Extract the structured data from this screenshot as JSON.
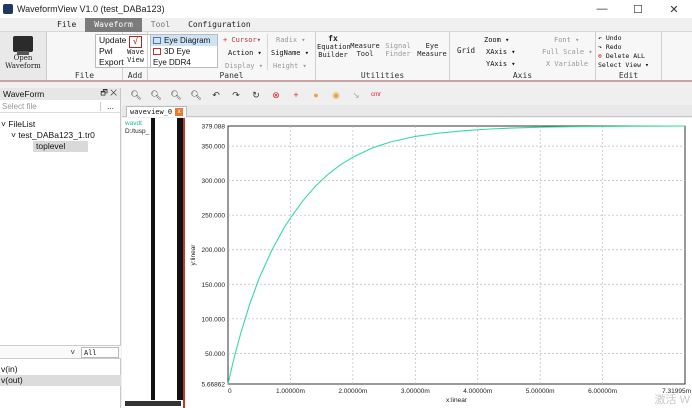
{
  "window": {
    "title": "WaveformView V1.0 (test_DABa123)",
    "controls": [
      "—",
      "☐",
      "✕"
    ]
  },
  "menu": {
    "tabs": [
      {
        "label": "File",
        "state": "normal"
      },
      {
        "label": "Waveform",
        "state": "active"
      },
      {
        "label": "Tool",
        "state": "dim"
      },
      {
        "label": "Configuration",
        "state": "normal"
      }
    ]
  },
  "ribbon": {
    "open_waveform": "Open Waveform",
    "file_items": [
      "Update",
      "Pwl",
      "Export"
    ],
    "file_group": "File",
    "wave_view": "Wave View",
    "add_group": "Add",
    "eye_items": [
      "Eye Diagram",
      "3D Eye",
      "Eye DDR4"
    ],
    "cursor_btn": "+ Cursor▾",
    "action_btn": "Action ▾",
    "display_btn": "Display ▾",
    "radix_btn": "Radix ▾",
    "signame_btn": "SigName ▾",
    "height_btn": "Height ▾",
    "panel_group": "Panel",
    "equation_builder": "Equation Builder",
    "measure_tool": "Measure Tool",
    "signal_finder": "Signal Finder",
    "eye_measure": "Eye Measure",
    "utilities_group": "Utilities",
    "grid_btn": "Grid",
    "zoom_btn": "Zoom ▾",
    "xaxis_btn": "XAxis ▾",
    "yaxis_btn": "YAxis ▾",
    "font_btn": "Font ▾",
    "fullscale_btn": "Full Scale ▾",
    "xvariable_btn": "X Variable",
    "axis_group": "Axis",
    "undo": "Undo",
    "redo": "Redo",
    "delete_all": "Delete ALL",
    "select_view": "Select View ▾",
    "edit_group": "Edit"
  },
  "left_panel": {
    "title": "WaveForm",
    "header_icons": "🗗 ✕",
    "filter_placeholder": "Select file",
    "filter_button": "...",
    "tree": [
      {
        "label": "˅ FileList",
        "indent": 0,
        "selected": false
      },
      {
        "label": "˅ test_DABa123_1.tr0",
        "indent": 1,
        "selected": false
      },
      {
        "label": "toplevel",
        "indent": 2,
        "selected": true
      }
    ],
    "scope_value": "All",
    "scope_arrow": "˅",
    "signals": [
      {
        "label": "v(in)",
        "selected": false
      },
      {
        "label": "v(out)",
        "selected": true
      }
    ]
  },
  "wave_toolbar": {
    "icons": [
      {
        "name": "zoom-in-icon",
        "glyph": "🔍︎",
        "cls": ""
      },
      {
        "name": "zoom-out-icon",
        "glyph": "🔍︎",
        "cls": ""
      },
      {
        "name": "zoom-fit-icon",
        "glyph": "🔍︎",
        "cls": ""
      },
      {
        "name": "zoom-area-icon",
        "glyph": "🔍︎",
        "cls": ""
      },
      {
        "name": "undo-view-icon",
        "glyph": "↶",
        "cls": ""
      },
      {
        "name": "redo-view-icon",
        "glyph": "↷",
        "cls": ""
      },
      {
        "name": "refresh-icon",
        "glyph": "↻",
        "cls": ""
      },
      {
        "name": "stop-icon",
        "glyph": "⊗",
        "cls": "red"
      },
      {
        "name": "crosshair-icon",
        "glyph": "+",
        "cls": "red"
      },
      {
        "name": "marker-icon",
        "glyph": "●",
        "cls": "org"
      },
      {
        "name": "delta-marker-icon",
        "glyph": "◉",
        "cls": "org"
      },
      {
        "name": "measure-icon",
        "glyph": "↘",
        "cls": "faint"
      },
      {
        "name": "cmr-icon",
        "glyph": "cmr",
        "cls": "tiny"
      }
    ]
  },
  "wave_tab": {
    "label": "waveview_0",
    "close": "x"
  },
  "signal_column": {
    "group": "wavdt",
    "signal": "D:/tusp_"
  },
  "chart_data": {
    "type": "line",
    "xlabel": "x:linear",
    "ylabel": "y:linear",
    "xlim": [
      0,
      7.31995
    ],
    "ylim": [
      5.66862,
      379.088
    ],
    "xticks": [
      {
        "v": 0,
        "label": "0"
      },
      {
        "v": 1,
        "label": "1.00000m"
      },
      {
        "v": 2,
        "label": "2.00000m"
      },
      {
        "v": 3,
        "label": "3.00000m"
      },
      {
        "v": 4,
        "label": "4.00000m"
      },
      {
        "v": 5,
        "label": "5.00000m"
      },
      {
        "v": 6,
        "label": "6.00000m"
      },
      {
        "v": 7.31995,
        "label": "7.31995m"
      }
    ],
    "yticks": [
      {
        "v": 5.66862,
        "label": "5.66862"
      },
      {
        "v": 50,
        "label": "50.000"
      },
      {
        "v": 100,
        "label": "100.000"
      },
      {
        "v": 150,
        "label": "150.000"
      },
      {
        "v": 200,
        "label": "200.000"
      },
      {
        "v": 250,
        "label": "250.000"
      },
      {
        "v": 300,
        "label": "300.000"
      },
      {
        "v": 350,
        "label": "350.000"
      },
      {
        "v": 379.088,
        "label": "379.088"
      }
    ],
    "grid": true,
    "series": [
      {
        "color": "#33dd99",
        "x": [
          0,
          0.1,
          0.2,
          0.35,
          0.5,
          0.7,
          0.9,
          1.0,
          1.2,
          1.4,
          1.6,
          1.8,
          2.0,
          2.3,
          2.6,
          3.0,
          3.4,
          3.8,
          4.2,
          4.6,
          5.0,
          5.5,
          6.0,
          6.5,
          7.0,
          7.31995
        ],
        "y": [
          5.67,
          44.0,
          78.0,
          122.0,
          159.0,
          199.0,
          232.0,
          246.0,
          271.0,
          292.0,
          309.0,
          323.0,
          334.0,
          347.0,
          356.0,
          364.0,
          369.0,
          372.5,
          374.8,
          376.3,
          377.3,
          378.1,
          378.5,
          378.8,
          379.0,
          379.088
        ]
      }
    ]
  },
  "watermark": "激活 W"
}
